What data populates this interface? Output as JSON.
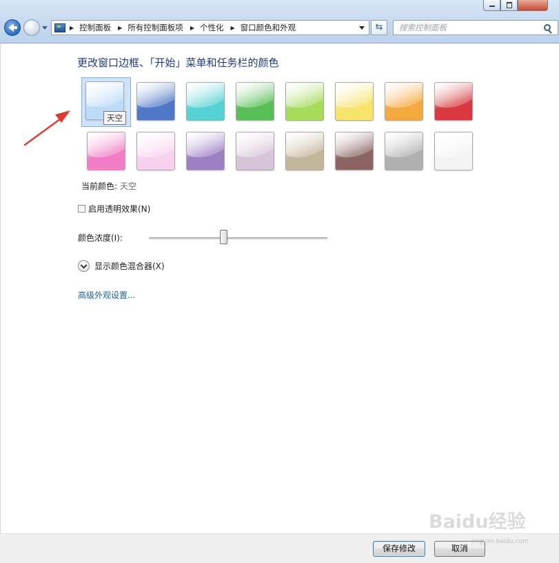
{
  "address_bar": {
    "breadcrumbs": [
      "控制面板",
      "所有控制面板项",
      "个性化",
      "窗口颜色和外观"
    ]
  },
  "search": {
    "placeholder": "搜索控制面板"
  },
  "refresh_glyph": "⇆",
  "main": {
    "title": "更改窗口边框、「开始」菜单和任务栏的颜色",
    "swatches": [
      {
        "name": "天空",
        "color": "#bcdcfa",
        "selected": true
      },
      {
        "color": "#4f79c8"
      },
      {
        "color": "#54d3d4"
      },
      {
        "color": "#57bf55"
      },
      {
        "color": "#a6dc5a"
      },
      {
        "color": "#f7e46b"
      },
      {
        "color": "#f6a93c"
      },
      {
        "color": "#d9393f"
      },
      {
        "color": "#f27cc5"
      },
      {
        "color": "#f7d2ef"
      },
      {
        "color": "#9d7fc4"
      },
      {
        "color": "#d6c5d9"
      },
      {
        "color": "#c3b79b"
      },
      {
        "color": "#8b6463"
      },
      {
        "color": "#b0b0b0"
      },
      {
        "color": "#f3f3f3"
      }
    ],
    "tooltip": "天空",
    "current_color_label": "当前颜色:",
    "current_color_value": "天空",
    "transparency_label": "启用透明效果(N)",
    "transparency_checked": false,
    "intensity_label": "颜色浓度(I):",
    "intensity_value": 0.42,
    "mixer_label": "显示颜色混合器(X)",
    "advanced_link": "高级外观设置..."
  },
  "footer": {
    "save_label": "保存修改",
    "cancel_label": "取消"
  },
  "watermark": {
    "text": "Baidu经验",
    "sub": "jingyan.baidu.com"
  },
  "annotation_arrow_color": "#e23b2e"
}
